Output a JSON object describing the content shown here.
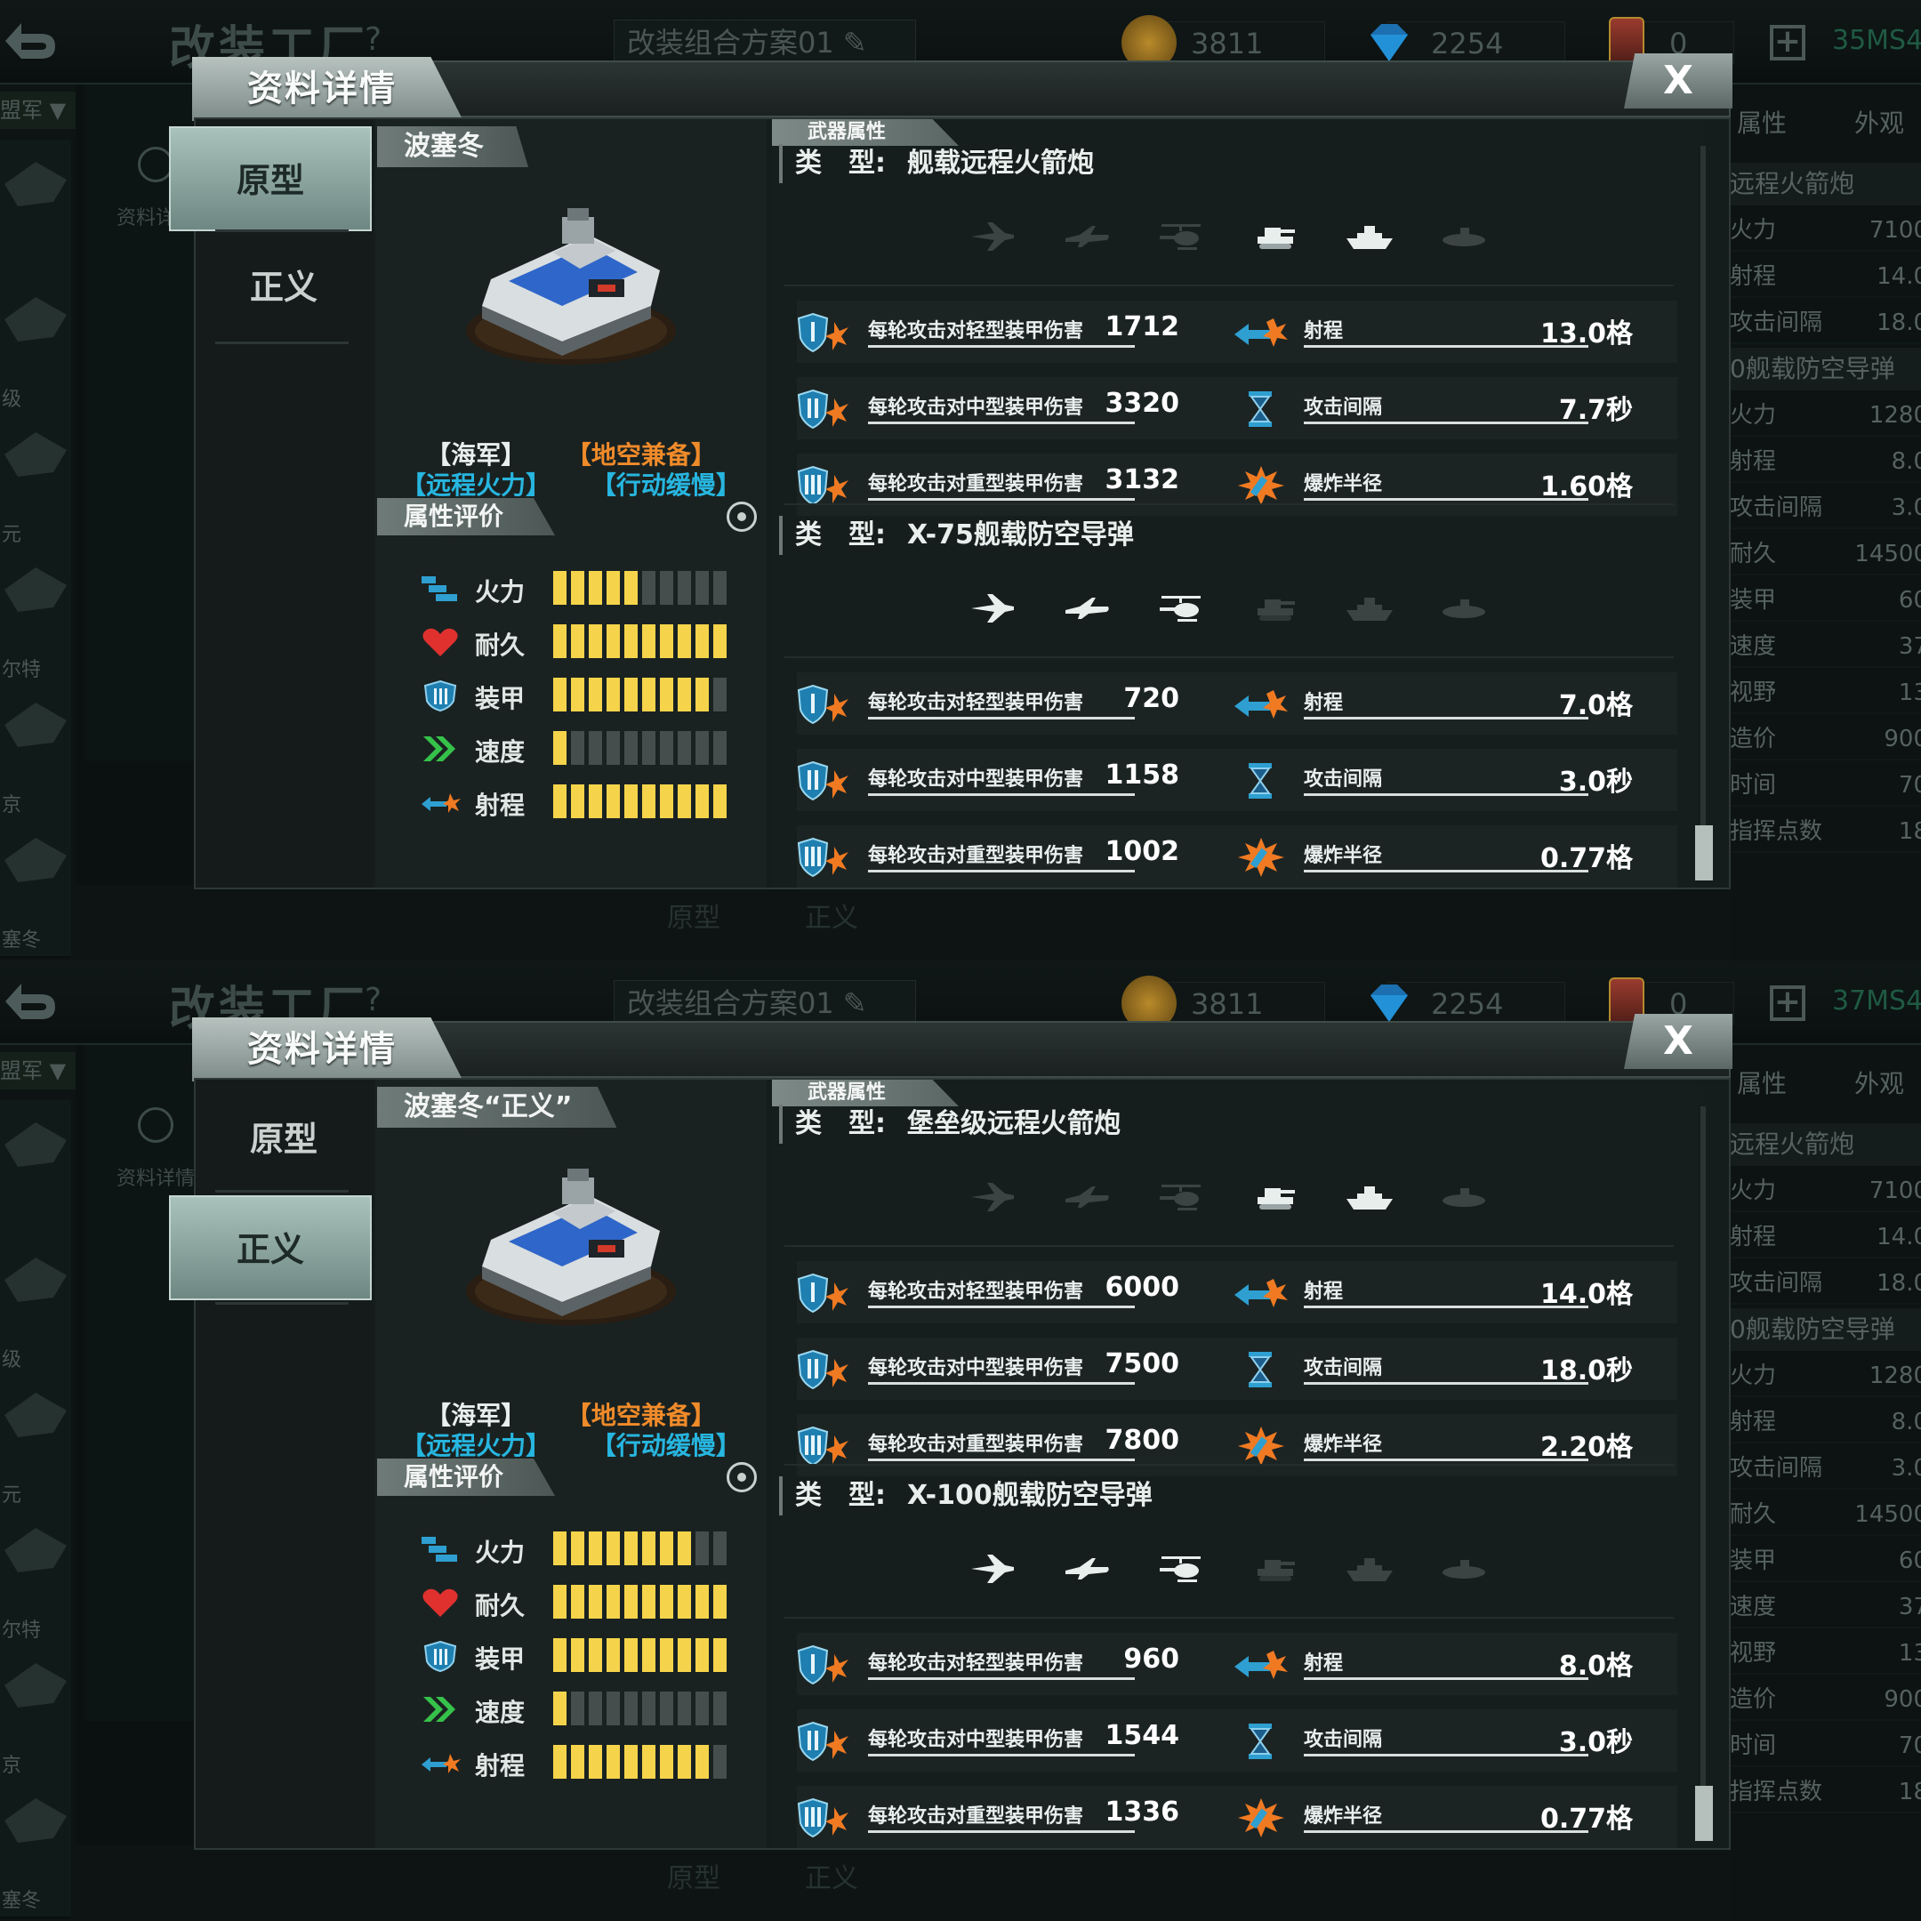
{
  "header": {
    "title": "改装工厂",
    "help": "?",
    "plan_name": "改装组合方案01",
    "coins": "3811",
    "gems": "2254",
    "cards": "0",
    "plus": "+"
  },
  "background": {
    "filter_label": "盟军 ▼",
    "zoom_label": "资料详情",
    "right_tabs": [
      "属性",
      "外观"
    ],
    "right_rows": [
      {
        "type": "header",
        "label": "远程火箭炮",
        "value": ""
      },
      {
        "type": "row",
        "label": "火力",
        "value": "7100"
      },
      {
        "type": "row",
        "label": "射程",
        "value": "14.0"
      },
      {
        "type": "row",
        "label": "攻击间隔",
        "value": "18.0"
      },
      {
        "type": "header",
        "label": "0舰载防空导弹",
        "value": ""
      },
      {
        "type": "row",
        "label": "火力",
        "value": "1280"
      },
      {
        "type": "row",
        "label": "射程",
        "value": "8.0"
      },
      {
        "type": "row",
        "label": "攻击间隔",
        "value": "3.0"
      },
      {
        "type": "row",
        "label": "耐久",
        "value": "14500"
      },
      {
        "type": "row",
        "label": "装甲",
        "value": "60"
      },
      {
        "type": "row",
        "label": "速度",
        "value": "37"
      },
      {
        "type": "row",
        "label": "视野",
        "value": "13"
      },
      {
        "type": "row",
        "label": "造价",
        "value": "900"
      },
      {
        "type": "row",
        "label": "时间",
        "value": "70"
      },
      {
        "type": "row",
        "label": "指挥点数",
        "value": "18"
      }
    ],
    "ship_labels": [
      "",
      "级",
      "元",
      "尔特",
      "京",
      "塞冬"
    ],
    "bottom_tabs": [
      "原型",
      "正义"
    ]
  },
  "modal": {
    "title": "资料详情",
    "close": "X",
    "tabs": [
      "原型",
      "正义"
    ],
    "weapons_header": "武器属性",
    "type_label": "类　型:",
    "attr_header": "属性评价",
    "tags": [
      "【海军】",
      "【地空兼备】",
      "【远程火力】",
      "【行动缓慢】"
    ]
  },
  "panels": [
    {
      "active_tab": 0,
      "unit_name": "波塞冬",
      "score": "35MS4",
      "ratings": [
        {
          "name": "火力",
          "icon": "firepower-icon",
          "value": 5,
          "max": 10
        },
        {
          "name": "耐久",
          "icon": "heart-icon",
          "value": 10,
          "max": 10
        },
        {
          "name": "装甲",
          "icon": "armor-icon",
          "value": 9,
          "max": 10
        },
        {
          "name": "速度",
          "icon": "speed-icon",
          "value": 1,
          "max": 10
        },
        {
          "name": "射程",
          "icon": "range-icon",
          "value": 10,
          "max": 10
        }
      ],
      "weapons": [
        {
          "type": "舰载远程火箭炮",
          "targets": [
            false,
            false,
            false,
            true,
            true,
            false
          ],
          "stats": [
            [
              "每轮攻击对轻型装甲伤害",
              "1712",
              "射程",
              "13.0格"
            ],
            [
              "每轮攻击对中型装甲伤害",
              "3320",
              "攻击间隔",
              "7.7秒"
            ],
            [
              "每轮攻击对重型装甲伤害",
              "3132",
              "爆炸半径",
              "1.60格"
            ]
          ]
        },
        {
          "type": "X-75舰载防空导弹",
          "targets": [
            true,
            true,
            true,
            false,
            false,
            false
          ],
          "stats": [
            [
              "每轮攻击对轻型装甲伤害",
              "720",
              "射程",
              "7.0格"
            ],
            [
              "每轮攻击对中型装甲伤害",
              "1158",
              "攻击间隔",
              "3.0秒"
            ],
            [
              "每轮攻击对重型装甲伤害",
              "1002",
              "爆炸半径",
              "0.77格"
            ]
          ]
        }
      ]
    },
    {
      "active_tab": 1,
      "unit_name": "波塞冬“正义”",
      "score": "37MS4",
      "ratings": [
        {
          "name": "火力",
          "icon": "firepower-icon",
          "value": 8,
          "max": 10
        },
        {
          "name": "耐久",
          "icon": "heart-icon",
          "value": 10,
          "max": 10
        },
        {
          "name": "装甲",
          "icon": "armor-icon",
          "value": 10,
          "max": 10
        },
        {
          "name": "速度",
          "icon": "speed-icon",
          "value": 1,
          "max": 10
        },
        {
          "name": "射程",
          "icon": "range-icon",
          "value": 9,
          "max": 10
        }
      ],
      "weapons": [
        {
          "type": "堡垒级远程火箭炮",
          "targets": [
            false,
            false,
            false,
            true,
            true,
            false
          ],
          "stats": [
            [
              "每轮攻击对轻型装甲伤害",
              "6000",
              "射程",
              "14.0格"
            ],
            [
              "每轮攻击对中型装甲伤害",
              "7500",
              "攻击间隔",
              "18.0秒"
            ],
            [
              "每轮攻击对重型装甲伤害",
              "7800",
              "爆炸半径",
              "2.20格"
            ]
          ]
        },
        {
          "type": "X-100舰载防空导弹",
          "targets": [
            true,
            true,
            true,
            false,
            false,
            false
          ],
          "stats": [
            [
              "每轮攻击对轻型装甲伤害",
              "960",
              "射程",
              "8.0格"
            ],
            [
              "每轮攻击对中型装甲伤害",
              "1544",
              "攻击间隔",
              "3.0秒"
            ],
            [
              "每轮攻击对重型装甲伤害",
              "1336",
              "爆炸半径",
              "0.77格"
            ]
          ]
        }
      ]
    }
  ],
  "colors": {
    "accent_orange": "#f08b2a",
    "accent_cyan": "#27b6e0",
    "rating_on": "#f5d44b",
    "rating_off": "#454e4c"
  }
}
